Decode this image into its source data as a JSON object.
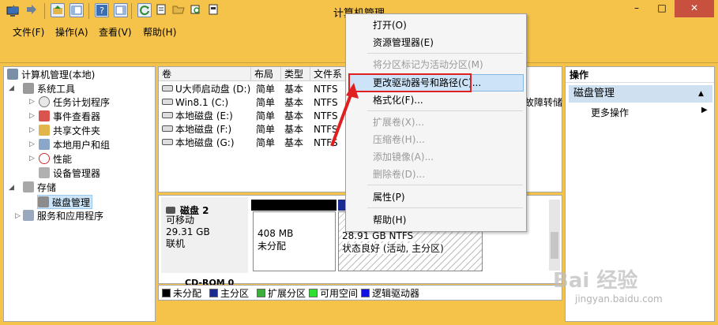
{
  "window": {
    "title": "计算机管理",
    "minimize": "–",
    "maximize": "□",
    "close": "✕"
  },
  "menubar": {
    "items": [
      "文件(F)",
      "操作(A)",
      "查看(V)",
      "帮助(H)"
    ]
  },
  "tree": {
    "root": "计算机管理(本地)",
    "system_tools": "系统工具",
    "task_scheduler": "任务计划程序",
    "event_viewer": "事件查看器",
    "shared_folders": "共享文件夹",
    "local_users": "本地用户和组",
    "performance": "性能",
    "device_manager": "设备管理器",
    "storage": "存储",
    "disk_management": "磁盘管理",
    "services": "服务和应用程序"
  },
  "volumes": {
    "headers": [
      "卷",
      "布局",
      "类型",
      "文件系"
    ],
    "rows": [
      {
        "name": "U大师启动盘 (D:)",
        "layout": "简单",
        "type": "基本",
        "fs": "NTFS"
      },
      {
        "name": "Win8.1 (C:)",
        "layout": "简单",
        "type": "基本",
        "fs": "NTFS"
      },
      {
        "name": "本地磁盘 (E:)",
        "layout": "简单",
        "type": "基本",
        "fs": "NTFS"
      },
      {
        "name": "本地磁盘 (F:)",
        "layout": "简单",
        "type": "基本",
        "fs": "NTFS"
      },
      {
        "name": "本地磁盘 (G:)",
        "layout": "简单",
        "type": "基本",
        "fs": "NTFS"
      }
    ],
    "partial_status": "故障转储"
  },
  "disk": {
    "name": "磁盘 2",
    "kind": "可移动",
    "size": "29.31 GB",
    "status": "联机",
    "part1_size": "408 MB",
    "part1_state": "未分配",
    "part2_size": "28.91 GB NTFS",
    "part2_state": "状态良好 (活动, 主分区)",
    "next_disk": "CD-ROM 0"
  },
  "legend": [
    {
      "label": "未分配",
      "color": "#000000"
    },
    {
      "label": "主分区",
      "color": "#1a2a8f"
    },
    {
      "label": "扩展分区",
      "color": "#3cae3c"
    },
    {
      "label": "可用空间",
      "color": "#30e030"
    },
    {
      "label": "逻辑驱动器",
      "color": "#1010e0"
    }
  ],
  "actions": {
    "header": "操作",
    "section": "磁盘管理",
    "more": "更多操作"
  },
  "context_menu": {
    "open": "打开(O)",
    "explorer": "资源管理器(E)",
    "mark_active": "将分区标记为活动分区(M)",
    "change_letter": "更改驱动器号和路径(C)...",
    "format": "格式化(F)...",
    "extend": "扩展卷(X)...",
    "shrink": "压缩卷(H)...",
    "add_mirror": "添加镜像(A)...",
    "delete": "删除卷(D)...",
    "properties": "属性(P)",
    "help": "帮助(H)"
  },
  "watermark": {
    "main": "Bai 经验",
    "sub": "jingyan.baidu.com"
  }
}
